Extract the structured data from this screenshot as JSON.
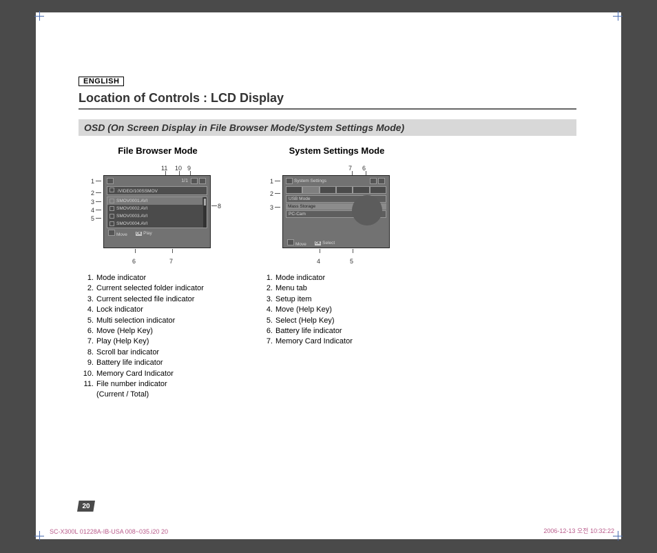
{
  "header": {
    "language": "ENGLISH",
    "title": "Location of Controls : LCD Display",
    "subtitle": "OSD (On Screen Display in File Browser Mode/System Settings Mode)"
  },
  "columns": {
    "filebrowser": {
      "heading": "File Browser Mode",
      "lcd": {
        "file_count": "1/1",
        "path": "/VIDEO/100SSMOV",
        "rows": [
          "SMOV0001.AVI",
          "SMOV0002.AVI",
          "SMOV0003.AVI",
          "SMOV0004.AVI"
        ],
        "move": "Move",
        "play": "Play",
        "ok": "OK"
      },
      "legend": [
        "Mode indicator",
        "Current selected folder indicator",
        "Current selected file indicator",
        "Lock indicator",
        "Multi selection indicator",
        "Move (Help Key)",
        "Play (Help Key)",
        "Scroll bar indicator",
        "Battery life indicator",
        "Memory Card Indicator",
        "File number indicator"
      ],
      "legend_sub": "(Current / Total)"
    },
    "system": {
      "heading": "System Settings Mode",
      "lcd": {
        "title": "System Settings",
        "usb_label": "USB Mode",
        "opt1": "Mass Storage",
        "opt2": "PC-Cam",
        "move": "Move",
        "select": "Select",
        "ok": "OK"
      },
      "legend": [
        "Mode indicator",
        "Menu tab",
        "Setup item",
        "Move (Help Key)",
        "Select (Help Key)",
        "Battery life indicator",
        "Memory Card Indicator"
      ]
    }
  },
  "page_number": "20",
  "footer": {
    "left": "SC-X300L 01228A-IB-USA 008~035.i20   20",
    "right": "2006-12-13   오전 10:32:22"
  },
  "callouts": {
    "fb": {
      "l1": "1",
      "l2": "2",
      "l3": "3",
      "l4": "4",
      "l5": "5",
      "b6": "6",
      "b7": "7",
      "r8": "8",
      "t9": "9",
      "t10": "10",
      "t11": "11"
    },
    "ss": {
      "l1": "1",
      "l2": "2",
      "l3": "3",
      "b4": "4",
      "b5": "5",
      "t6": "6",
      "t7": "7"
    }
  }
}
